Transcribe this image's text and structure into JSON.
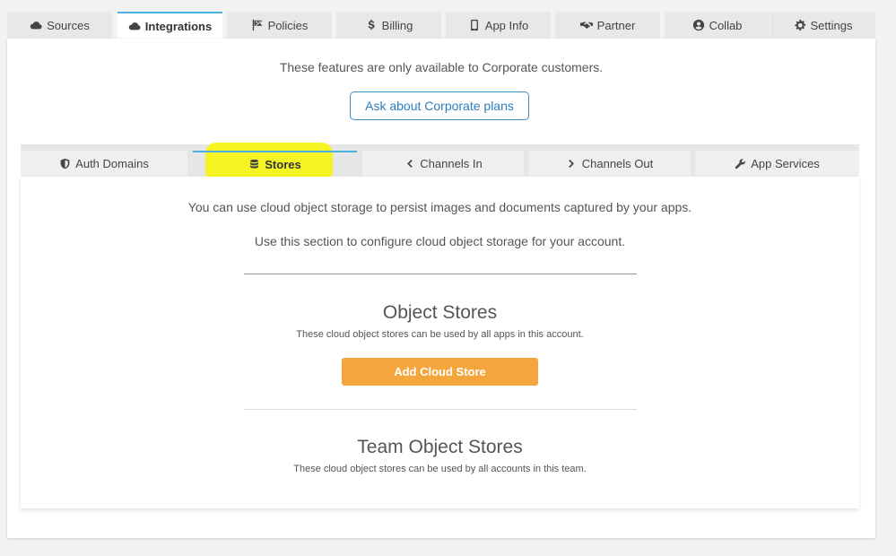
{
  "top_tabs": [
    {
      "label": "Sources",
      "icon": "cloud-icon"
    },
    {
      "label": "Integrations",
      "icon": "cloud-icon",
      "active": true
    },
    {
      "label": "Policies",
      "icon": "flag-icon"
    },
    {
      "label": "Billing",
      "icon": "dollar-icon"
    },
    {
      "label": "App Info",
      "icon": "mobile-icon"
    },
    {
      "label": "Partner",
      "icon": "handshake-icon"
    },
    {
      "label": "Collab",
      "icon": "user-circle-icon"
    },
    {
      "label": "Settings",
      "icon": "gear-icon"
    }
  ],
  "notice": {
    "text": "These features are only available to Corporate customers.",
    "button_label": "Ask about Corporate plans"
  },
  "sub_tabs": [
    {
      "label": "Auth Domains",
      "icon": "shield-icon"
    },
    {
      "label": "Stores",
      "icon": "database-icon",
      "active": true
    },
    {
      "label": "Channels In",
      "icon": "chevron-left-icon"
    },
    {
      "label": "Channels Out",
      "icon": "chevron-right-icon"
    },
    {
      "label": "App Services",
      "icon": "wrench-icon"
    }
  ],
  "stores": {
    "intro_1": "You can use cloud object storage to persist images and documents captured by your apps.",
    "intro_2": "Use this section to configure cloud object storage for your account.",
    "object_stores_title": "Object Stores",
    "object_stores_sub": "These cloud object stores can be used by all apps in this account.",
    "add_button": "Add Cloud Store",
    "team_title": "Team Object Stores",
    "team_sub": "These cloud object stores can be used by all accounts in this team."
  },
  "colors": {
    "accent_blue": "#4ab0de",
    "link_blue": "#2f7dbd",
    "orange_button": "#f4a53c",
    "highlight_yellow": "#f4f41a"
  }
}
